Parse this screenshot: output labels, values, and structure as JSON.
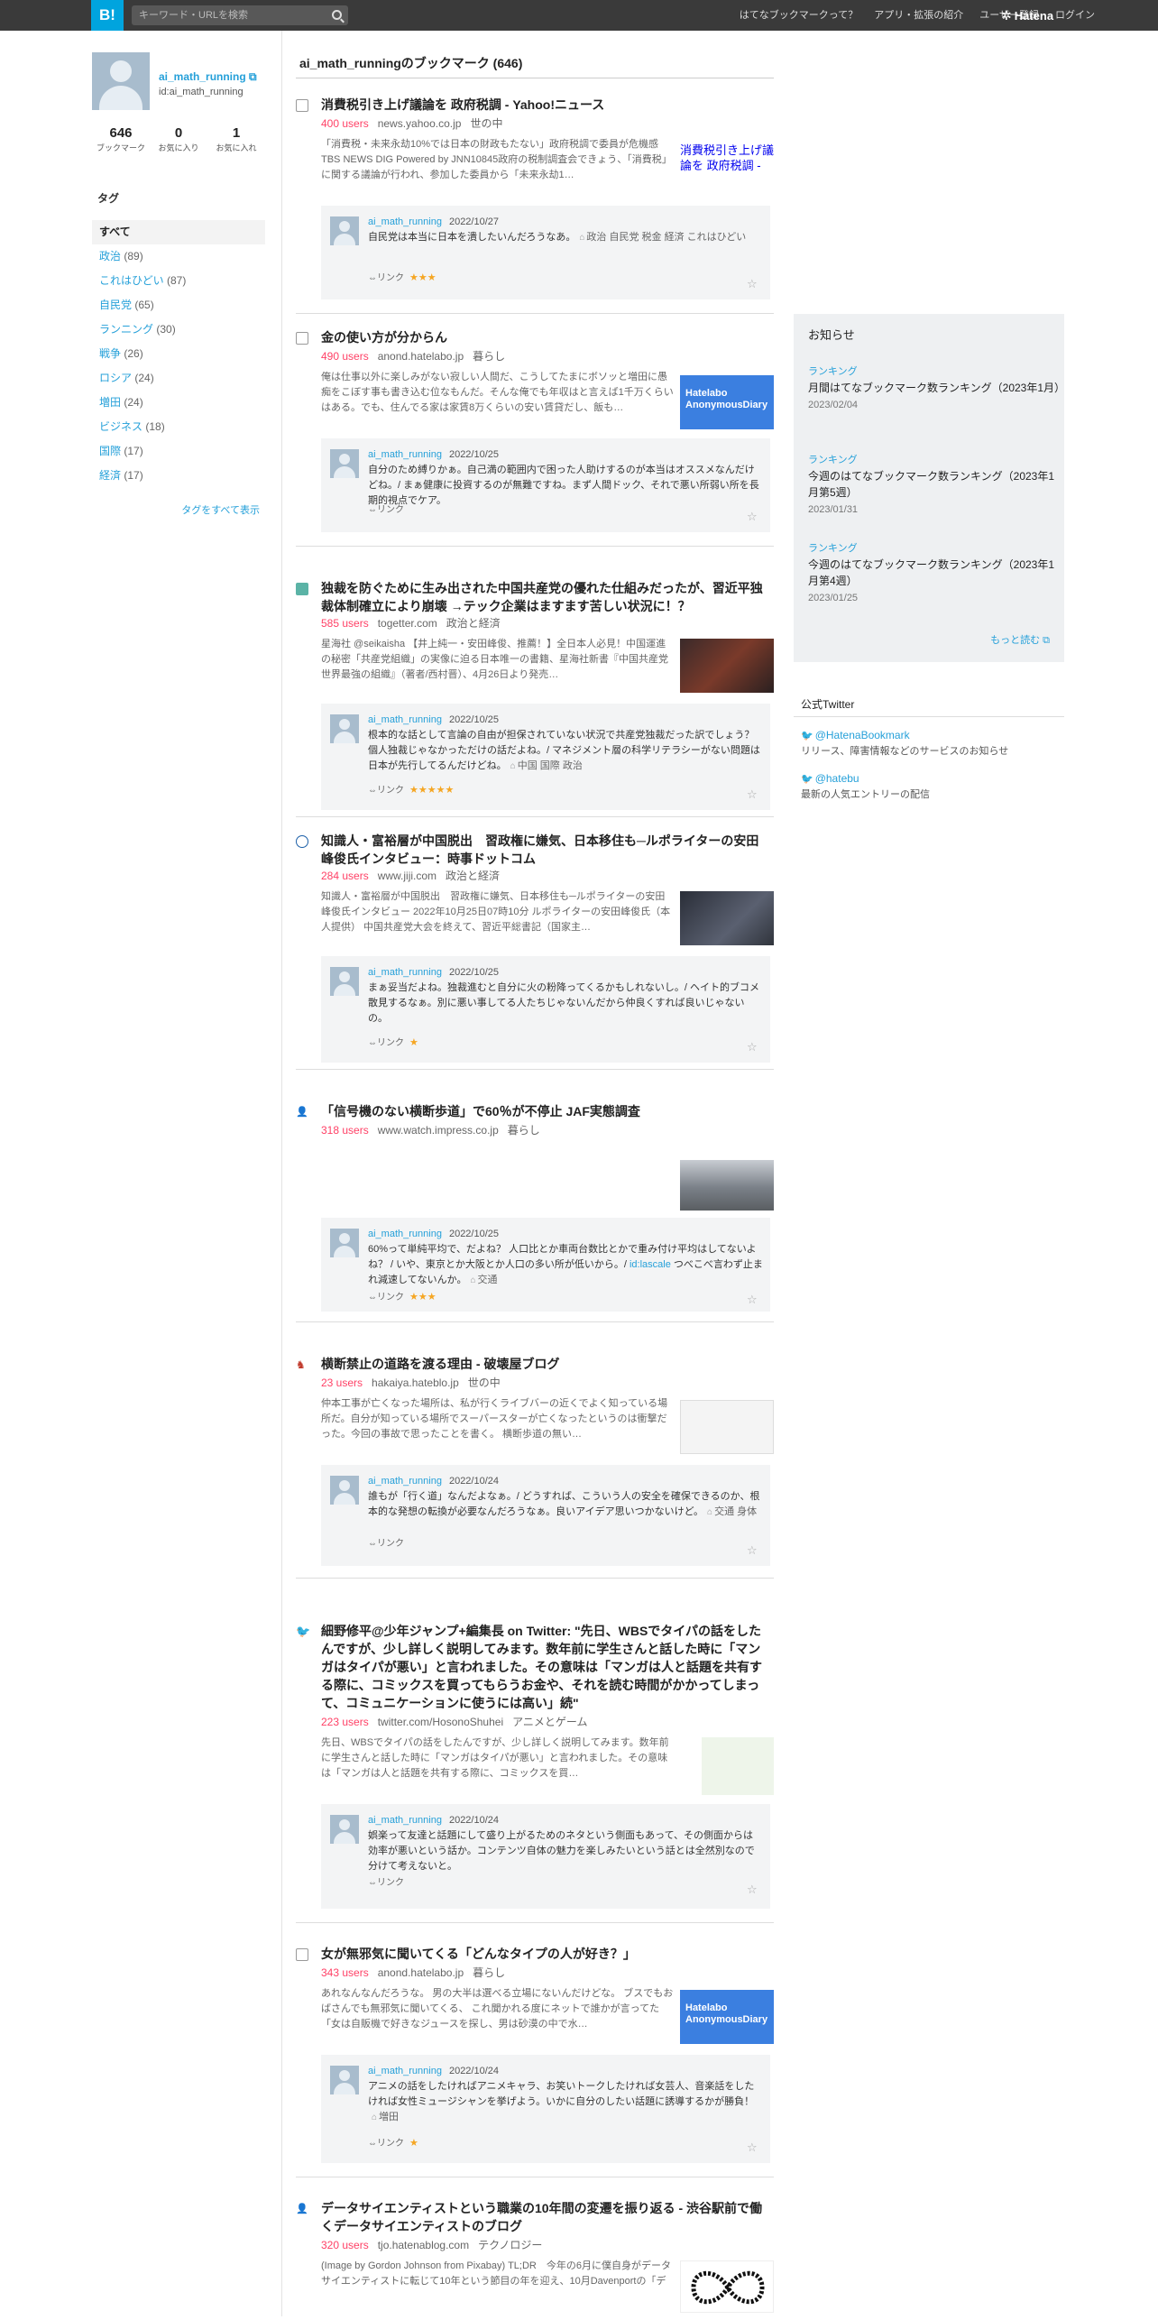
{
  "topbar": {
    "logo": "B!",
    "search_placeholder": "キーワード・URLを検索",
    "nav": [
      "はてなブックマークって？",
      "アプリ・拡張の紹介",
      "ユーザー登録",
      "ログイン"
    ],
    "brand": "Hatena"
  },
  "profile": {
    "username": "ai_math_running",
    "userid": "id:ai_math_running",
    "stats": [
      {
        "value": "646",
        "label": "ブックマーク"
      },
      {
        "value": "0",
        "label": "お気に入り"
      },
      {
        "value": "1",
        "label": "お気に入れ"
      }
    ]
  },
  "tags": {
    "heading": "タグ",
    "items": [
      {
        "name": "すべて",
        "count": ""
      },
      {
        "name": "政治",
        "count": "(89)"
      },
      {
        "name": "これはひどい",
        "count": "(87)"
      },
      {
        "name": "自民党",
        "count": "(65)"
      },
      {
        "name": "ランニング",
        "count": "(30)"
      },
      {
        "name": "戦争",
        "count": "(26)"
      },
      {
        "name": "ロシア",
        "count": "(24)"
      },
      {
        "name": "増田",
        "count": "(24)"
      },
      {
        "name": "ビジネス",
        "count": "(18)"
      },
      {
        "name": "国際",
        "count": "(17)"
      },
      {
        "name": "経済",
        "count": "(17)"
      }
    ],
    "show_all": "タグをすべて表示"
  },
  "page_title": "ai_math_runningのブックマーク (646)",
  "entries": [
    {
      "title": "消費税引き上げ議論を 政府税調 - Yahoo!ニュース",
      "users": "400 users",
      "domain": "news.yahoo.co.jp",
      "category": "世の中",
      "summary": "「消費税・未来永劫10%では日本の財政もたない」政府税調で委員が危機感 TBS NEWS DIG Powered by JNN10845政府の税制調査会できょう、「消費税」に関する議論が行われ、参加した委員から「未来永劫1…",
      "thumb_alt": "消費税引き上げ議論を 政府税調 -",
      "comment_user": "ai_math_running",
      "comment_date": "2022/10/27",
      "comment": "自民党は本当に日本を潰したいんだろうなあ。",
      "comment_tags": [
        "政治",
        "自民党",
        "税金",
        "経済",
        "これはひどい"
      ],
      "link": "⇔リンク",
      "stars": "★★★"
    },
    {
      "title": "金の使い方が分からん",
      "users": "490 users",
      "domain": "anond.hatelabo.jp",
      "category": "暮らし",
      "summary": "俺は仕事以外に楽しみがない寂しい人間だ、こうしてたまにボソッと増田に愚痴をこぼす事も書き込む位なもんだ。そんな俺でも年収はと言えば1千万くらいはある。でも、住んでる家は家賃8万くらいの安い賃貸だし、飯も…",
      "thumb_text": "Hatelabo AnonymousDiary",
      "comment_user": "ai_math_running",
      "comment_date": "2022/10/25",
      "comment": "自分のため縛りかぁ。自己満の範囲内で困った人助けするのが本当はオススメなんだけどね。/ まぁ健康に投資するのが無難ですね。まず人間ドック、それで悪い所弱い所を長期的視点でケア。",
      "comment_tags": [],
      "link": "⇔リンク",
      "stars": ""
    },
    {
      "title": "独裁を防ぐために生み出された中国共産党の優れた仕組みだったが、習近平独裁体制確立により崩壊 →テック企業はますます苦しい状況に！？",
      "users": "585 users",
      "domain": "togetter.com",
      "category": "政治と経済",
      "summary": "星海社 @seikaisha 【井上純一・安田峰俊、推薦！】全日本人必見！中国運進の秘密「共産党組織」の実像に迫る日本唯一の書籍、星海社新書『中国共産党　世界最強の組織』（著者/西村晋）、4月26日より発売…",
      "comment_user": "ai_math_running",
      "comment_date": "2022/10/25",
      "comment": "根本的な話として言論の自由が担保されていない状況で共産党独裁だった訳でしょう？ 個人独裁じゃなかっただけの話だよね。/ マネジメント層の科学リテラシーがない問題は日本が先行してるんだけどね。",
      "comment_tags": [
        "中国",
        "国際",
        "政治"
      ],
      "link": "⇔リンク",
      "stars": "★★★★★"
    },
    {
      "title": "知識人・富裕層が中国脱出　習政権に嫌気、日本移住も─ルポライターの安田峰俊氏インタビュー：時事ドットコム",
      "users": "284 users",
      "domain": "www.jiji.com",
      "category": "政治と経済",
      "summary": "知識人・富裕層が中国脱出　習政権に嫌気、日本移住も─ルポライターの安田峰俊氏インタビュー 2022年10月25日07時10分 ルポライターの安田峰俊氏（本人提供） 中国共産党大会を終えて、習近平総書記（国家主…",
      "comment_user": "ai_math_running",
      "comment_date": "2022/10/25",
      "comment": "まぁ妥当だよね。独裁進むと自分に火の粉降ってくるかもしれないし。/ ヘイト的ブコメ散見するなぁ。別に悪い事してる人たちじゃないんだから仲良くすれば良いじゃないの。",
      "comment_tags": [],
      "link": "⇔リンク",
      "stars": "★"
    },
    {
      "title": "「信号機のない横断歩道」で60％が不停止 JAF実態調査",
      "users": "318 users",
      "domain": "www.watch.impress.co.jp",
      "category": "暮らし",
      "summary": "",
      "comment_user": "ai_math_running",
      "comment_date": "2022/10/25",
      "comment": "60%って単純平均で、だよね？ 人口比とか車両台数比とかで重み付け平均はしてないよね？ / いや、東京とか大阪とか人口の多い所が低いから。/",
      "comment_mention": "id:lascale",
      "comment_after": "つべこべ言わず止まれ減速してないんか。",
      "comment_tags": [
        "交通"
      ],
      "link": "⇔リンク",
      "stars": "★★★"
    },
    {
      "title": "横断禁止の道路を渡る理由 - 破壊屋ブログ",
      "users": "23 users",
      "domain": "hakaiya.hateblo.jp",
      "category": "世の中",
      "summary": "仲本工事が亡くなった場所は、私が行くライブバーの近くでよく知っている場所だ。自分が知っている場所でスーパースターが亡くなったというのは衝撃だった。今回の事故で思ったことを書く。 横断歩道の無い…",
      "comment_user": "ai_math_running",
      "comment_date": "2022/10/24",
      "comment": "誰もが「行く道」なんだよなぁ。/ どうすれば、こういう人の安全を確保できるのか、根本的な発想の転換が必要なんだろうなぁ。良いアイデア思いつかないけど。",
      "comment_tags": [
        "交通",
        "身体"
      ],
      "link": "⇔リンク",
      "stars": ""
    },
    {
      "title": "細野修平@少年ジャンプ+編集長 on Twitter: \"先日、WBSでタイパの話をしたんですが、少し詳しく説明してみます。数年前に学生さんと話した時に「マンガはタイパが悪い」と言われました。その意味は「マンガは人と話題を共有する際に、コミックスを買ってもらうお金や、それを読む時間がかかってしまって、コミュニケーションに使うには高い」続\"",
      "users": "223 users",
      "domain": "twitter.com/HosonoShuhei",
      "category": "アニメとゲーム",
      "summary": "先日、WBSでタイパの話をしたんですが、少し詳しく説明してみます。数年前に学生さんと話した時に「マンガはタイパが悪い」と言われました。その意味は「マンガは人と話題を共有する際に、コミックスを買…",
      "comment_user": "ai_math_running",
      "comment_date": "2022/10/24",
      "comment": "娯楽って友達と話題にして盛り上がるためのネタという側面もあって、その側面からは効率が悪いという話か。コンテンツ自体の魅力を楽しみたいという話とは全然別なので分けて考えないと。",
      "comment_tags": [],
      "link": "⇔リンク",
      "stars": ""
    },
    {
      "title": "女が無邪気に聞いてくる「どんなタイプの人が好き？」",
      "users": "343 users",
      "domain": "anond.hatelabo.jp",
      "category": "暮らし",
      "summary": "あれなんなんだろうな。 男の大半は選べる立場にないんだけどな。 ブスでもおばさんでも無邪気に聞いてくる、 これ聞かれる度にネットで誰かが言ってた「女は自販機で好きなジュースを探し、男は砂漠の中で水…",
      "thumb_text": "Hatelabo AnonymousDiary",
      "comment_user": "ai_math_running",
      "comment_date": "2022/10/24",
      "comment": "アニメの話をしたければアニメキャラ、お笑いトークしたければ女芸人、音楽話をしたければ女性ミュージシャンを挙げよう。いかに自分のしたい話題に誘導するかが勝負！",
      "comment_tags": [
        "増田"
      ],
      "link": "⇔リンク",
      "stars": "★"
    },
    {
      "title": "データサイエンティストという職業の10年間の変遷を振り返る - 渋谷駅前で働くデータサイエンティストのブログ",
      "users": "320 users",
      "domain": "tjo.hatenablog.com",
      "category": "テクノロジー",
      "summary": "(Image by Gordon Johnson from Pixabay) TL;DR　今年の6月に僕自身がデータサイエンティストに転じて10年という節目の年を迎え、10月Davenportの「データサイエンティストは21世紀で最もセクシーな職業で…"
    }
  ],
  "notices": {
    "heading": "お知らせ",
    "items": [
      {
        "category": "ランキング",
        "title": "月間はてなブックマーク数ランキング（2023年1月）",
        "date": "2023/02/04"
      },
      {
        "category": "ランキング",
        "title": "今週のはてなブックマーク数ランキング（2023年1月第5週）",
        "date": "2023/01/31"
      },
      {
        "category": "ランキング",
        "title": "今週のはてなブックマーク数ランキング（2023年1月第4週）",
        "date": "2023/01/25"
      }
    ],
    "more": "もっと読む"
  },
  "twitter": {
    "heading": "公式Twitter",
    "items": [
      {
        "handle": "@HatenaBookmark",
        "desc": "リリース、障害情報などのサービスのお知らせ"
      },
      {
        "handle": "@hatebu",
        "desc": "最新の人気エントリーの配信"
      }
    ]
  }
}
